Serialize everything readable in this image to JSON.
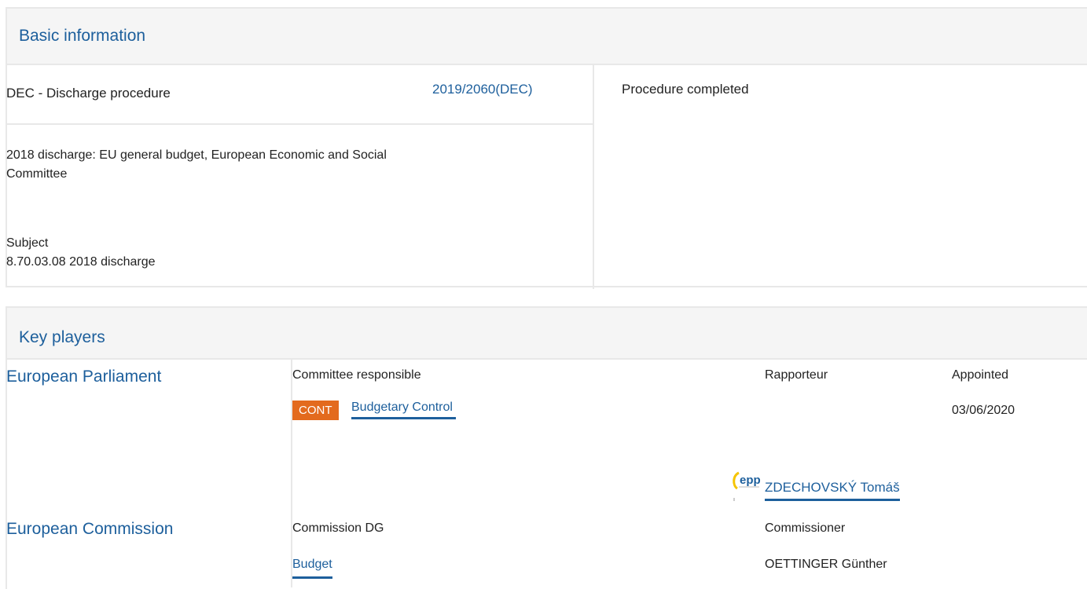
{
  "basic": {
    "header": "Basic information",
    "type": "DEC - Discharge procedure",
    "reference": "2019/2060(DEC)",
    "status": "Procedure completed",
    "title_line1": "2018 discharge: EU general budget, European Economic and Social",
    "title_line2": "Committee",
    "subject_label": "Subject",
    "subject_value": "8.70.03.08 2018 discharge"
  },
  "players": {
    "header": "Key players",
    "ep": {
      "label": "European Parliament",
      "committee_header": "Committee responsible",
      "rapporteur_header": "Rapporteur",
      "appointed_header": "Appointed",
      "committee_abbr": "CONT",
      "committee_name": "Budgetary Control",
      "appointed_date": "03/06/2020",
      "group_logo": "epp",
      "rapporteur_name": "ZDECHOVSKÝ Tomáš"
    },
    "ec": {
      "label": "European Commission",
      "dg_header": "Commission DG",
      "commissioner_header": "Commissioner",
      "dg_name": "Budget",
      "commissioner_name": "OETTINGER Günther"
    }
  },
  "colors": {
    "link": "#1d5f9c",
    "tag": "#e36a1e",
    "border": "#e8e8e8",
    "header_bg": "#f5f5f5"
  }
}
